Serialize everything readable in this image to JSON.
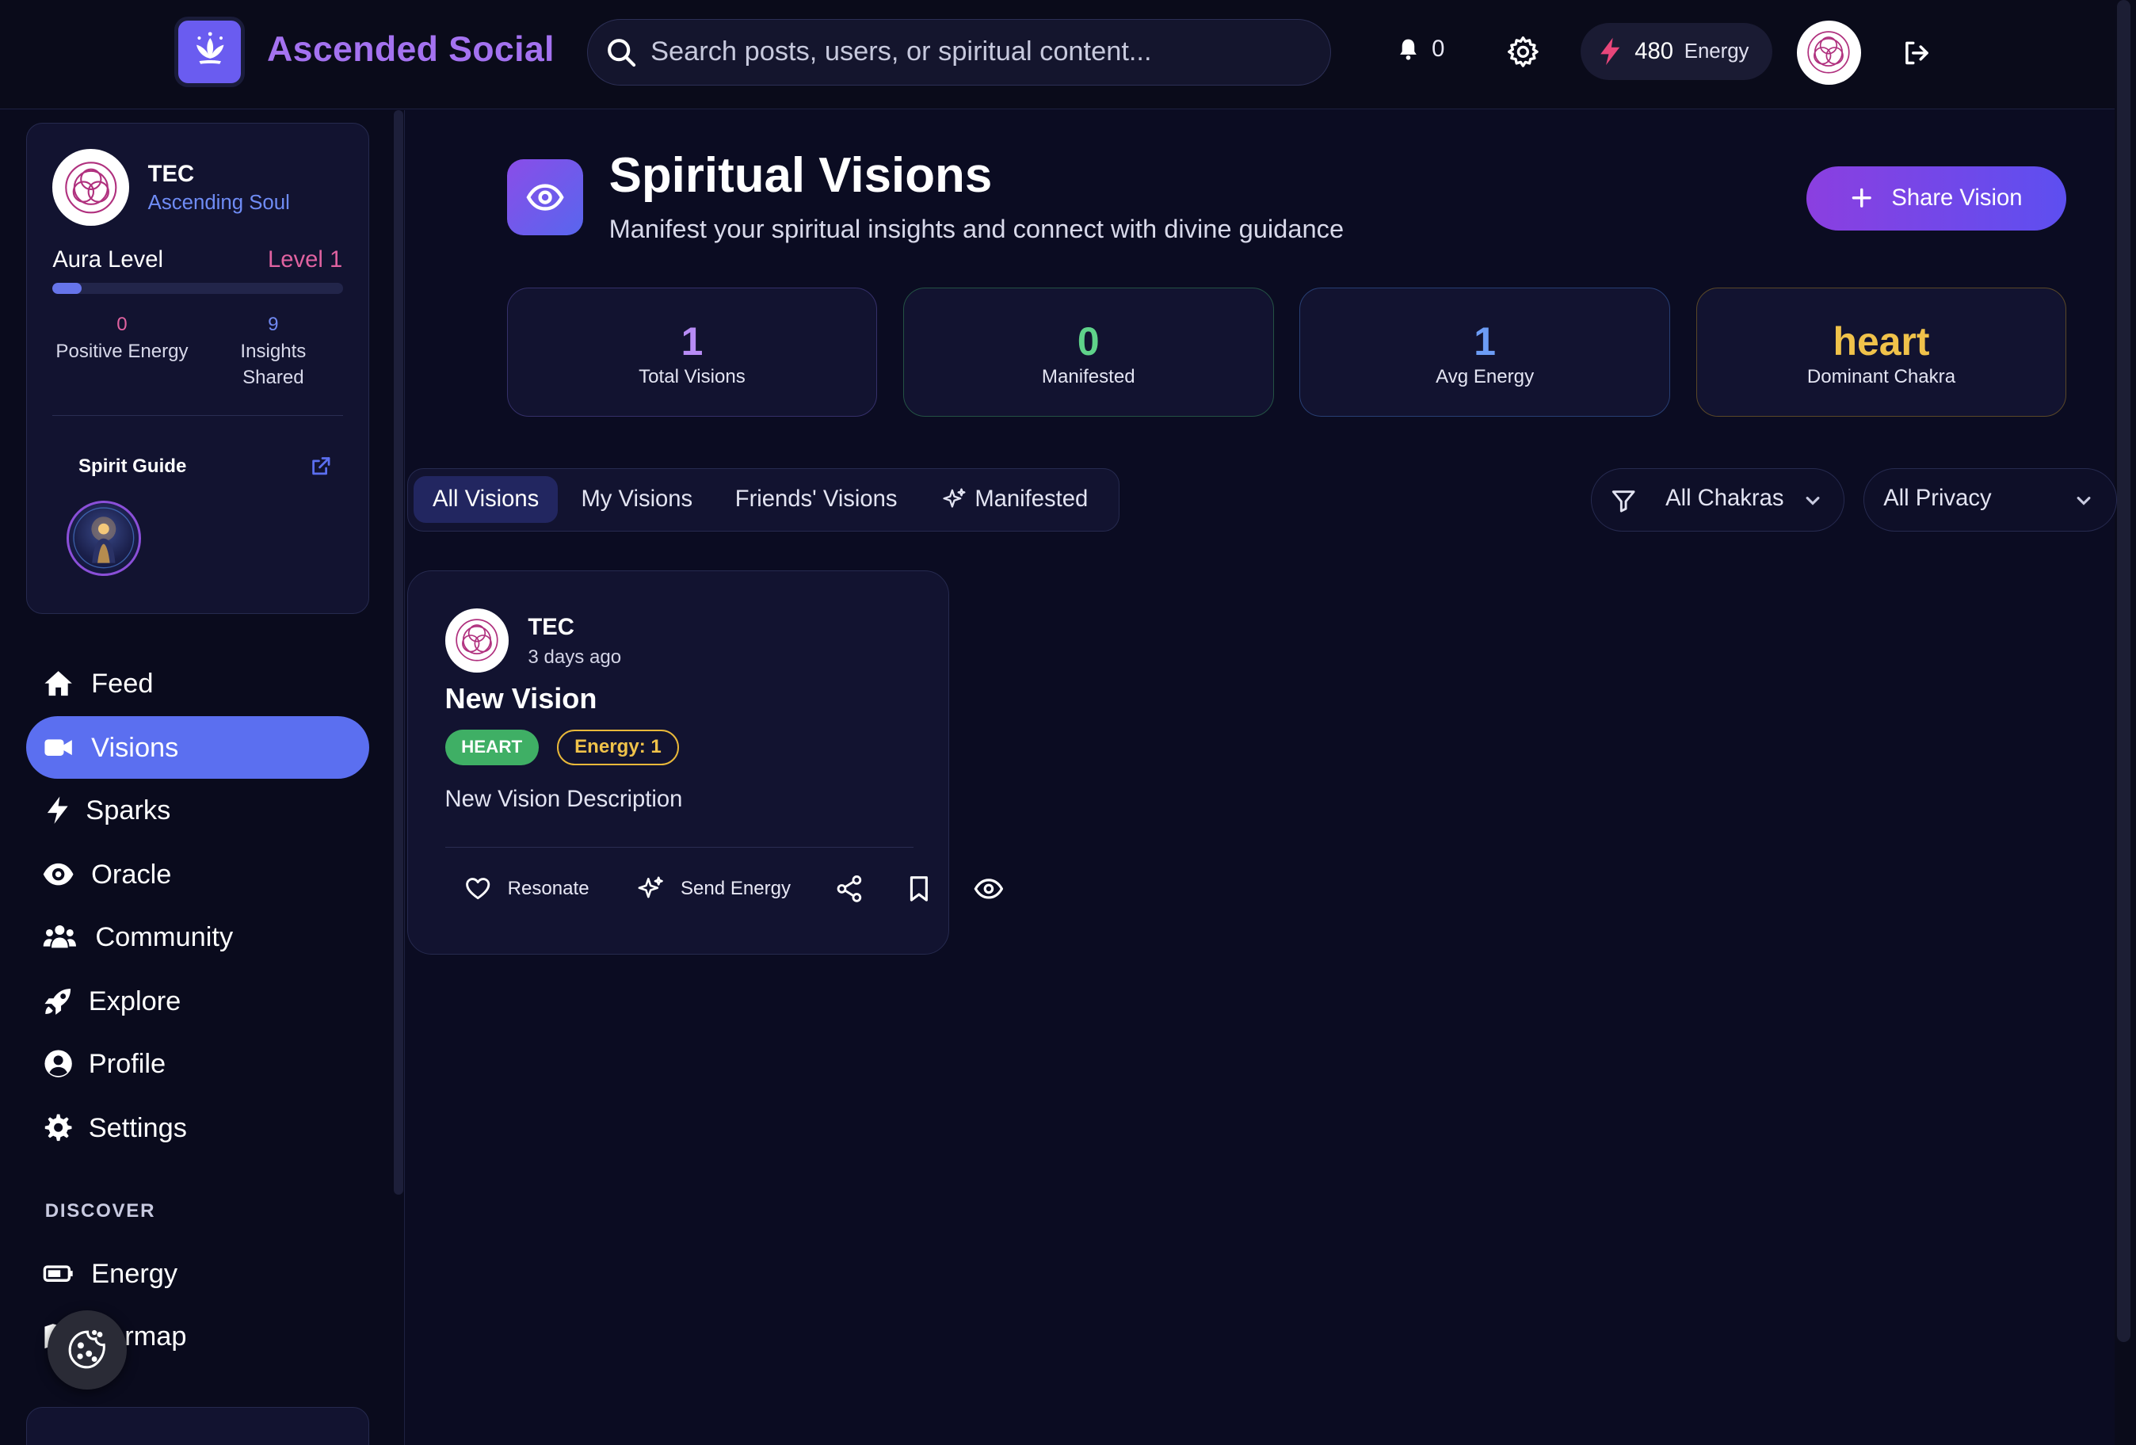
{
  "header": {
    "brand": "Ascended Social",
    "search_placeholder": "Search posts, users, or spiritual content...",
    "notifications_count": "0",
    "energy_value": "480",
    "energy_label": "Energy"
  },
  "sidebar": {
    "profile": {
      "name": "TEC",
      "rank": "Ascending Soul",
      "aura_label": "Aura Level",
      "aura_level": "Level 1",
      "aura_progress": 0.1,
      "positive_energy_value": "0",
      "positive_energy_label": "Positive Energy",
      "insights_value": "9",
      "insights_label_1": "Insights",
      "insights_label_2": "Shared",
      "spirit_guide_label": "Spirit Guide"
    },
    "nav": [
      {
        "label": "Feed",
        "icon": "home-icon"
      },
      {
        "label": "Visions",
        "icon": "video-icon"
      },
      {
        "label": "Sparks",
        "icon": "bolt-icon"
      },
      {
        "label": "Oracle",
        "icon": "eye-icon"
      },
      {
        "label": "Community",
        "icon": "users-icon"
      },
      {
        "label": "Explore",
        "icon": "rocket-icon"
      },
      {
        "label": "Profile",
        "icon": "user-circle-icon"
      },
      {
        "label": "Settings",
        "icon": "gear-icon"
      }
    ],
    "discover_label": "DISCOVER",
    "discover_items": [
      {
        "label": "Energy",
        "icon": "battery-icon"
      },
      {
        "label": "Karmap",
        "icon": "map-icon"
      }
    ]
  },
  "main": {
    "title": "Spiritual Visions",
    "subtitle": "Manifest your spiritual insights and connect with divine guidance",
    "share_button": "Share Vision",
    "stats": [
      {
        "value": "1",
        "label": "Total Visions",
        "color": "#b78cf5"
      },
      {
        "value": "0",
        "label": "Manifested",
        "color": "#5fd28a"
      },
      {
        "value": "1",
        "label": "Avg Energy",
        "color": "#6c9cf5"
      },
      {
        "value": "heart",
        "label": "Dominant Chakra",
        "color": "#f0c24a"
      }
    ],
    "tabs": [
      "All Visions",
      "My Visions",
      "Friends' Visions",
      "Manifested"
    ],
    "filter_chakra": "All Chakras",
    "filter_privacy": "All Privacy",
    "post": {
      "author": "TEC",
      "time": "3 days ago",
      "title": "New Vision",
      "chakra_badge": "HEART",
      "energy_badge": "Energy: 1",
      "description": "New Vision Description",
      "resonate_label": "Resonate",
      "send_energy_label": "Send Energy"
    }
  },
  "colors": {
    "background": "#0b0c22",
    "accent": "#5b6ff0",
    "brand": "#a472f0",
    "heart": "#3faf65",
    "energy": "#f0c24a"
  }
}
